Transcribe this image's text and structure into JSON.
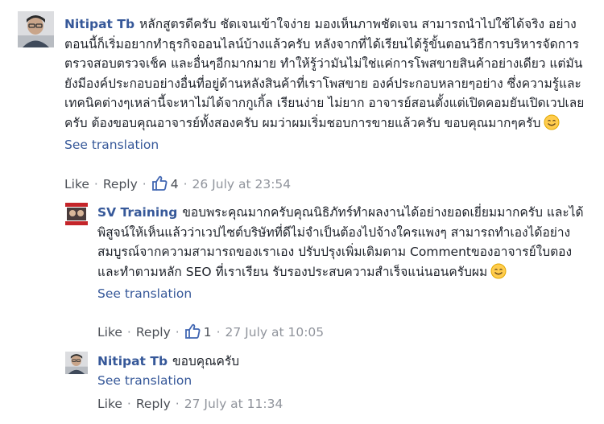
{
  "comments": [
    {
      "author": "Nitipat Tb",
      "text": "หลักสูตรดีครับ ชัดเจนเข้าใจง่าย มองเห็นภาพชัดเจน สามารถนำไปใช้ได้จริง อย่างตอนนี้ก็เริ่มอยากทำธุรกิจออนไลน์บ้างแล้วครับ หลังจากที่ได้เรียนได้รู้ขั้นตอนวิธีการบริหารจัดการ ตรวจสอบตรวจเช็ค และอื่นๆอีกมากมาย ทำให้รู้ว่ามันไม่ใช่แค่การโพสขายสินค้าอย่างเดียว แต่มันยังมีองค์ประกอบอย่างอื่นที่อยู่ด้านหลังสินค้าที่เราโพสขาย องค์ประกอบหลายๆอย่าง ซึ่งความรู้และเทคนิคต่างๆเหล่านี้จะหาไม่ได้จากกูเกิ้ล เรียนง่าย ไม่ยาก อาจารย์สอนตั้งแต่เปิดคอมยันเปิดเวปเลยครับ ต้องขอบคุณอาจารย์ทั้งสองครับ ผมว่าผมเริ่มชอบการขายแล้วครับ ขอบคุณมากๆครับ",
      "see_translation": "See translation",
      "like": "Like",
      "reply": "Reply",
      "like_count": "4",
      "timestamp": "26 July at 23:54"
    },
    {
      "author": "SV Training",
      "text": "ขอบพระคุณมากครับคุณนิธิภัทร์ทำผลงานได้อย่างยอดเยี่ยมมากครับ และได้พิสูจน์ให้เห็นแล้วว่าเวปไซต์บริษัทที่ดีไม่จำเป็นต้องไปจ้างใครแพงๆ สามารถทำเองได้อย่างสมบูรณ์จากความสามารถของเราเอง ปรับปรุงเพิ่มเติมตาม Commentของอาจารย์ใบตอง และทำตามหลัก SEO ที่เราเรียน รับรองประสบความสำเร็จแน่นอนครับผม",
      "see_translation": "See translation",
      "like": "Like",
      "reply": "Reply",
      "like_count": "1",
      "timestamp": "27 July at 10:05"
    },
    {
      "author": "Nitipat Tb",
      "text": "ขอบคุณครับ",
      "see_translation": "See translation",
      "like": "Like",
      "reply": "Reply",
      "timestamp": "27 July at 11:34"
    }
  ],
  "icons": {
    "like": "thumbs-up-icon",
    "emoji": "smiley-icon",
    "accent": "#365899",
    "like_blue": "#4267b2"
  }
}
